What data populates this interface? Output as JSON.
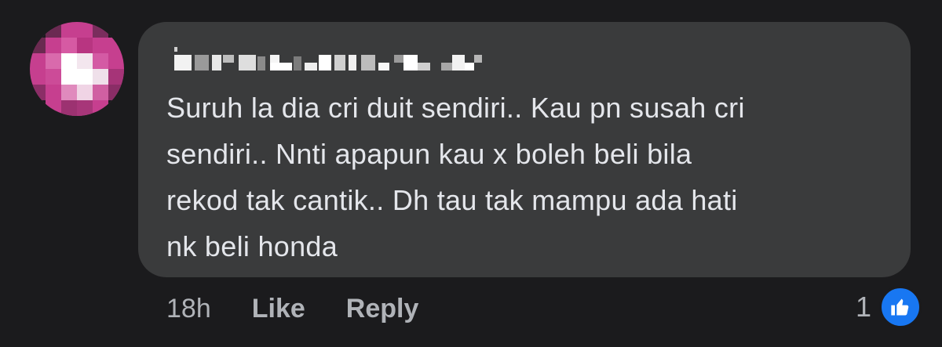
{
  "comment": {
    "author_name_pixelated": true,
    "text": "Suruh la dia cri duit sendiri.. Kau pn susah cri\nsendiri.. Nnti apapun kau x boleh beli bila\nrekod tak cantik.. Dh tau tak mampu ada hati\nnk beli honda",
    "timestamp": "18h",
    "like_label": "Like",
    "reply_label": "Reply",
    "reaction_count": "1",
    "reaction_icon": "thumbs-up-icon"
  },
  "colors": {
    "background": "#1b1b1d",
    "bubble": "#3a3b3c",
    "text": "#e4e6eb",
    "secondary_text": "#b0b3b8",
    "like_blue": "#1877f2",
    "avatar_accent": "#c43c8c"
  }
}
